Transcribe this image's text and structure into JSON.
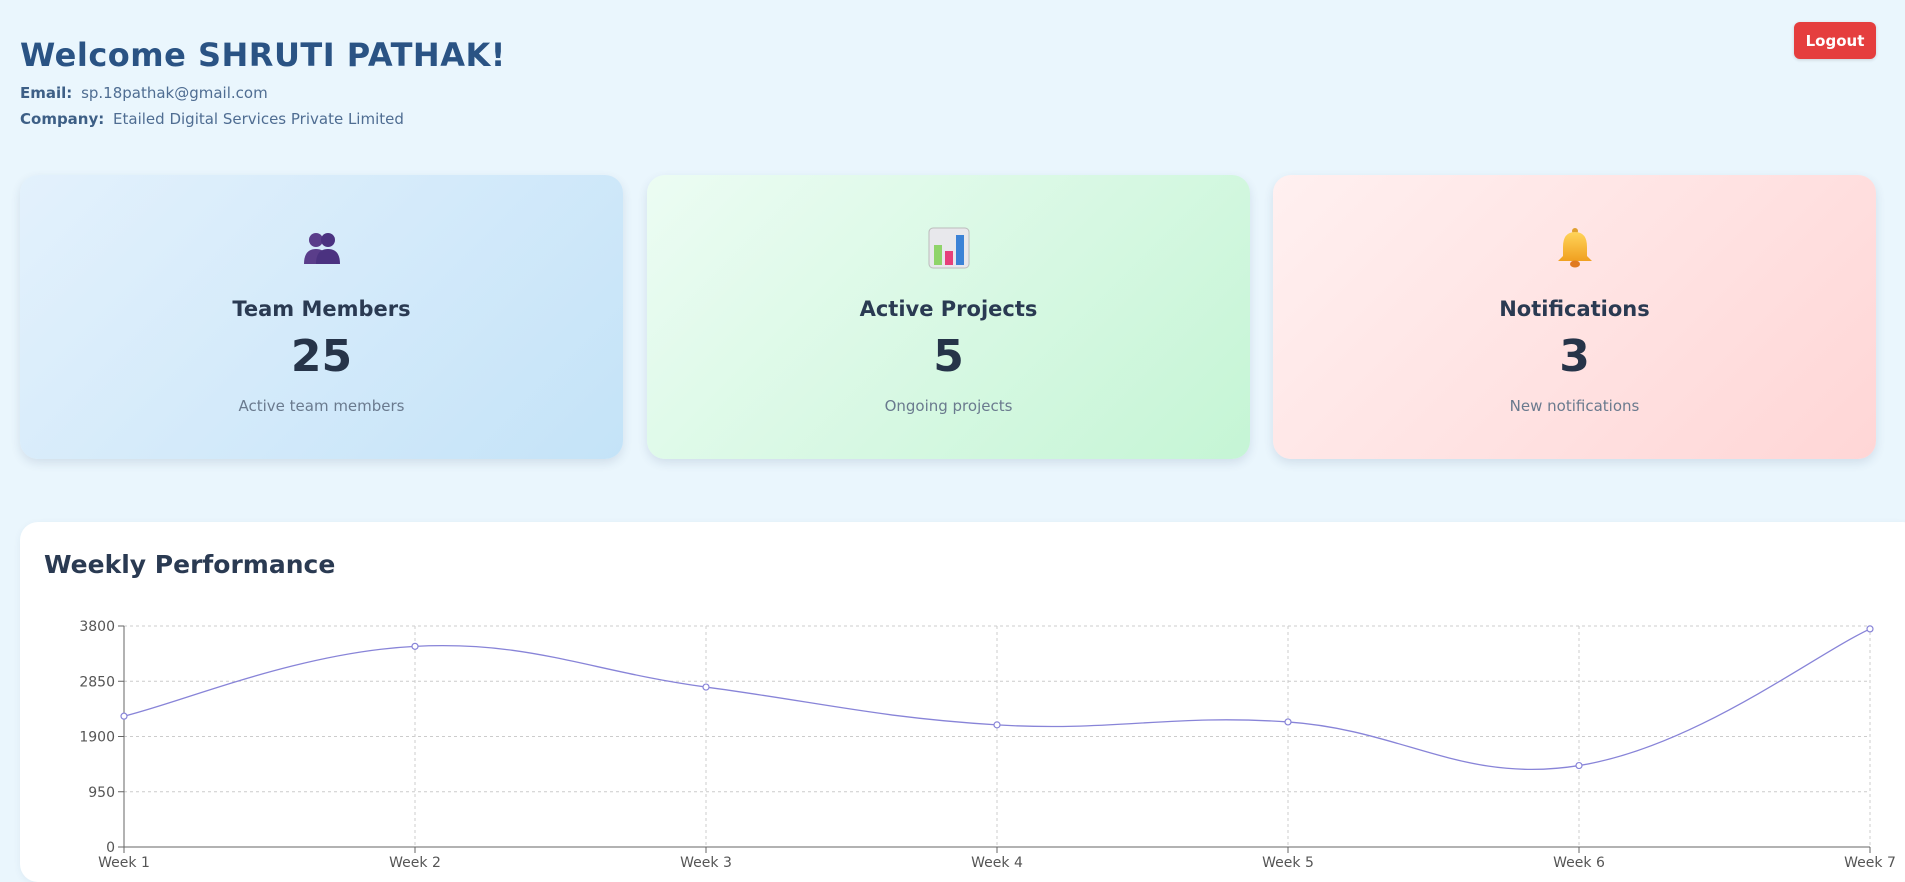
{
  "header": {
    "welcome": "Welcome SHRUTI PATHAK!",
    "email_label": "Email:",
    "email": "sp.18pathak@gmail.com",
    "company_label": "Company:",
    "company": "Etailed Digital Services Private Limited"
  },
  "logout_label": "Logout",
  "cards": [
    {
      "icon": "team-members-icon",
      "title": "Team Members",
      "value": "25",
      "subtitle": "Active team members"
    },
    {
      "icon": "bar-chart-icon",
      "title": "Active Projects",
      "value": "5",
      "subtitle": "Ongoing projects"
    },
    {
      "icon": "bell-icon",
      "title": "Notifications",
      "value": "3",
      "subtitle": "New notifications"
    }
  ],
  "performance": {
    "title": "Weekly Performance"
  },
  "chart_data": {
    "type": "line",
    "x": [
      "Week 1",
      "Week 2",
      "Week 3",
      "Week 4",
      "Week 5",
      "Week 6",
      "Week 7"
    ],
    "series": [
      {
        "values": [
          2250,
          3450,
          2750,
          2100,
          2150,
          1400,
          3750
        ]
      }
    ],
    "yticks": [
      0,
      950,
      1900,
      2850,
      3800
    ],
    "ylim": [
      0,
      3800
    ],
    "grid": true,
    "line_color": "#8884d8"
  },
  "colors": {
    "accent": "#2a5384",
    "logout": "#e53e3e"
  }
}
